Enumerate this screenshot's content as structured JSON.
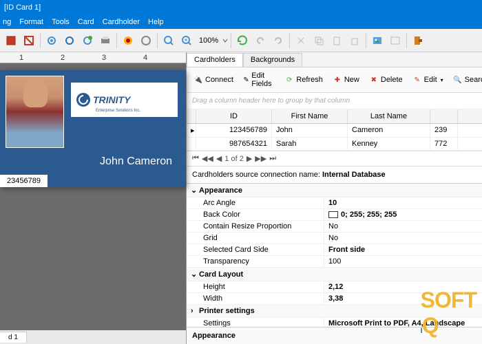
{
  "title": "[ID Card 1]",
  "menu": [
    "ng",
    "Format",
    "Tools",
    "Card",
    "Cardholder",
    "Help"
  ],
  "zoom": "100%",
  "left_tab": "d 1",
  "card": {
    "logo_name": "TRINITY",
    "logo_sub": "Enterprise Solutions Inc.",
    "name": "John  Cameron",
    "id": "23456789"
  },
  "tabs": {
    "active": "Cardholders",
    "other": "Backgrounds"
  },
  "subtoolbar": {
    "connect": "Connect",
    "edit_fields": "Edit Fields",
    "refresh": "Refresh",
    "new": "New",
    "delete": "Delete",
    "edit": "Edit",
    "search": "Search"
  },
  "group_hint": "Drag a column header here to group by that column",
  "columns": [
    "",
    "ID",
    "First Name",
    "Last Name",
    ""
  ],
  "rows": [
    {
      "id": "123456789",
      "first": "John",
      "last": "Cameron",
      "x": "239"
    },
    {
      "id": "987654321",
      "first": "Sarah",
      "last": "Kenney",
      "x": "772"
    }
  ],
  "pager": "1 of 2",
  "source_label": "Cardholders source connection name:",
  "source_value": "Internal Database",
  "groups": {
    "appearance": "Appearance",
    "layout": "Card Layout",
    "printer": "Printer settings"
  },
  "props": {
    "arc_angle": {
      "k": "Arc Angle",
      "v": "10"
    },
    "back_color": {
      "k": "Back Color",
      "v": "0; 255; 255; 255"
    },
    "resize": {
      "k": "Contain Resize Proportion",
      "v": "No"
    },
    "grid": {
      "k": "Grid",
      "v": "No"
    },
    "side": {
      "k": "Selected Card Side",
      "v": "Front side"
    },
    "trans": {
      "k": "Transparency",
      "v": "100"
    },
    "height": {
      "k": "Height",
      "v": "2,12"
    },
    "width": {
      "k": "Width",
      "v": "3,38"
    },
    "settings": {
      "k": "Settings",
      "v": "Microsoft Print to PDF, A4, Landscape"
    }
  },
  "prop_footer": "Appearance"
}
